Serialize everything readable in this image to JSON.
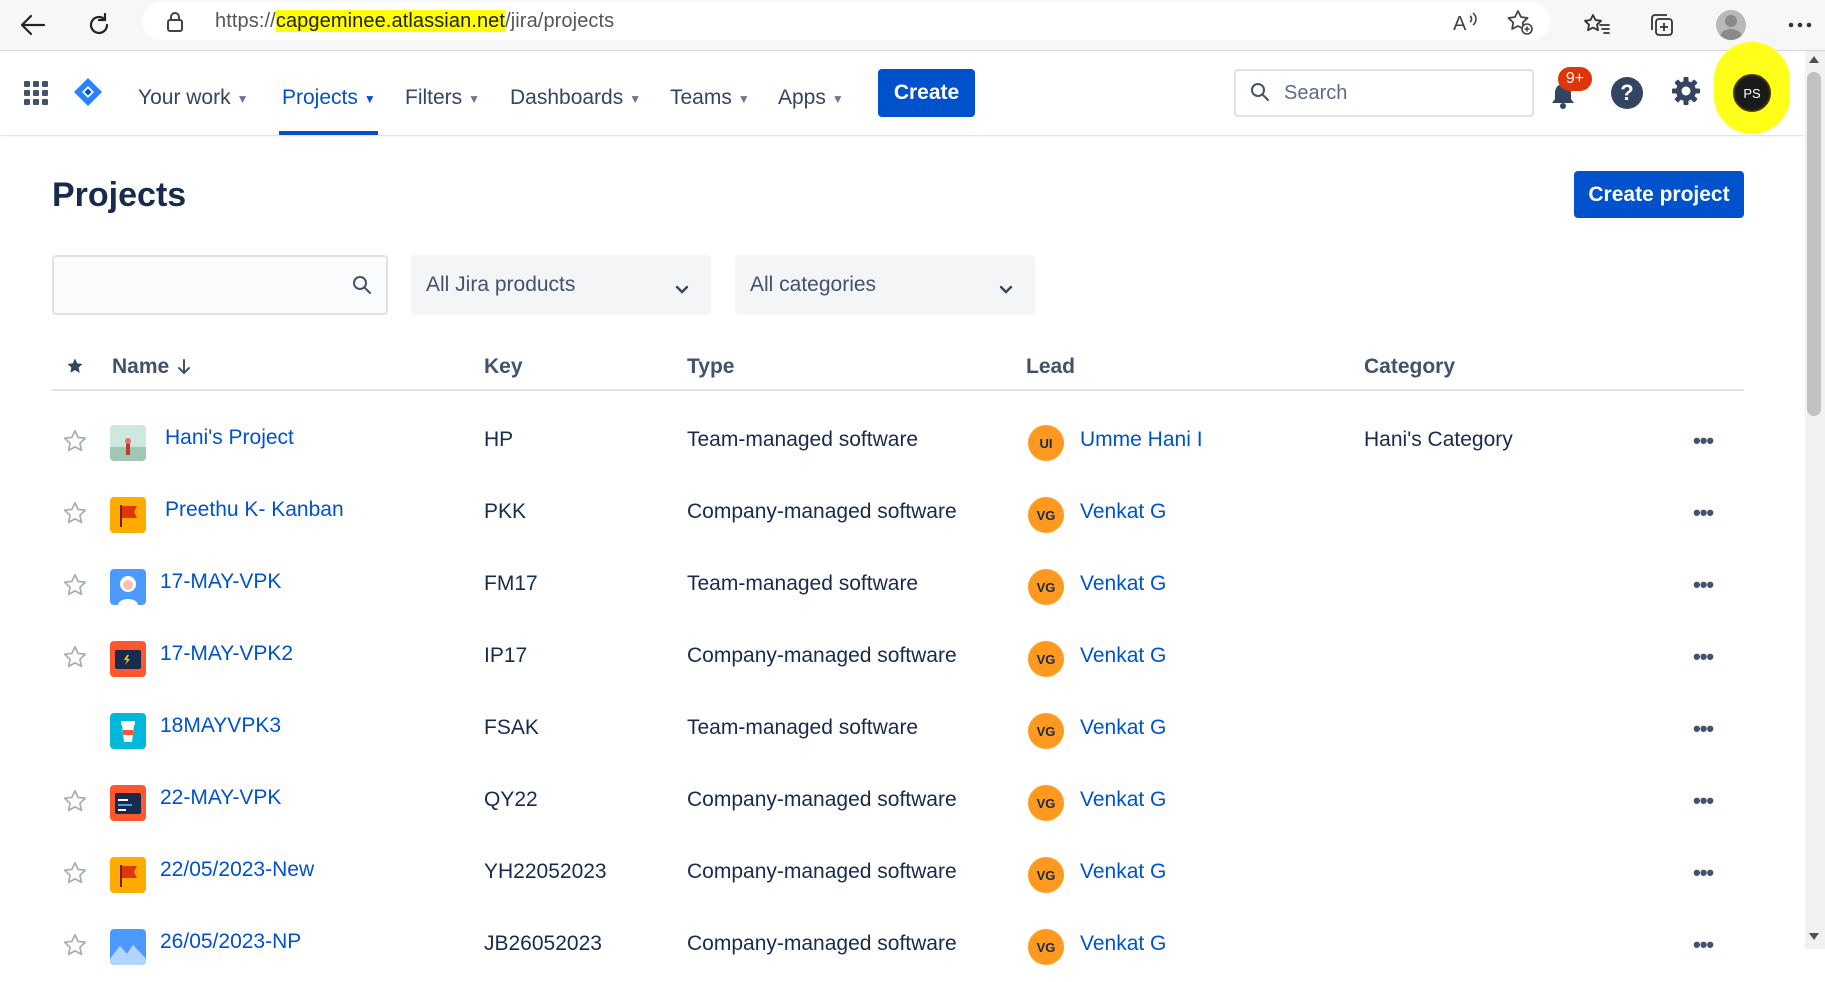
{
  "browser": {
    "url_prefix": "https://",
    "url_highlight": "capgeminee.atlassian.net",
    "url_suffix": "/jira/projects"
  },
  "nav": {
    "items": [
      {
        "label": "Your work"
      },
      {
        "label": "Projects"
      },
      {
        "label": "Filters"
      },
      {
        "label": "Dashboards"
      },
      {
        "label": "Teams"
      },
      {
        "label": "Apps"
      }
    ],
    "create_label": "Create",
    "search_placeholder": "Search",
    "notifications_badge": "9+",
    "help_label": "?",
    "user_initials": "PS"
  },
  "page": {
    "title": "Projects",
    "create_project_label": "Create project",
    "filter_search_value": "",
    "products_dropdown": "All Jira products",
    "categories_dropdown": "All categories"
  },
  "table": {
    "columns": {
      "name": "Name",
      "key": "Key",
      "type": "Type",
      "lead": "Lead",
      "category": "Category"
    },
    "rows": [
      {
        "name": "Hani's Project",
        "key": "HP",
        "type": "Team-managed software",
        "lead_initials": "UI",
        "lead": "Umme Hani I",
        "category": "Hani's Category",
        "icon": "landscape-photo-icon",
        "starred_visible": true
      },
      {
        "name": "Preethu K- Kanban",
        "key": "PKK",
        "type": "Company-managed software",
        "lead_initials": "VG",
        "lead": "Venkat G",
        "category": "",
        "icon": "flag-icon",
        "starred_visible": true
      },
      {
        "name": "17-MAY-VPK",
        "key": "FM17",
        "type": "Team-managed software",
        "lead_initials": "VG",
        "lead": "Venkat G",
        "category": "",
        "icon": "person-icon",
        "starred_visible": true
      },
      {
        "name": "17-MAY-VPK2",
        "key": "IP17",
        "type": "Company-managed software",
        "lead_initials": "VG",
        "lead": "Venkat G",
        "category": "",
        "icon": "terminal-icon",
        "starred_visible": true
      },
      {
        "name": "18MAYVPK3",
        "key": "FSAK",
        "type": "Team-managed software",
        "lead_initials": "VG",
        "lead": "Venkat G",
        "category": "",
        "icon": "coffee-cup-icon",
        "starred_visible": false
      },
      {
        "name": "22-MAY-VPK",
        "key": "QY22",
        "type": "Company-managed software",
        "lead_initials": "VG",
        "lead": "Venkat G",
        "category": "",
        "icon": "code-window-icon",
        "starred_visible": true
      },
      {
        "name": "22/05/2023-New",
        "key": "YH22052023",
        "type": "Company-managed software",
        "lead_initials": "VG",
        "lead": "Venkat G",
        "category": "",
        "icon": "flag-icon",
        "starred_visible": true
      },
      {
        "name": "26/05/2023-NP",
        "key": "JB26052023",
        "type": "Company-managed software",
        "lead_initials": "VG",
        "lead": "Venkat G",
        "category": "",
        "icon": "mountains-icon",
        "starred_visible": true
      }
    ]
  },
  "colors": {
    "accent": "#0052CC",
    "badge": "#DE350B",
    "lead_avatar": "#FF991F",
    "highlight": "#FFFF00"
  }
}
